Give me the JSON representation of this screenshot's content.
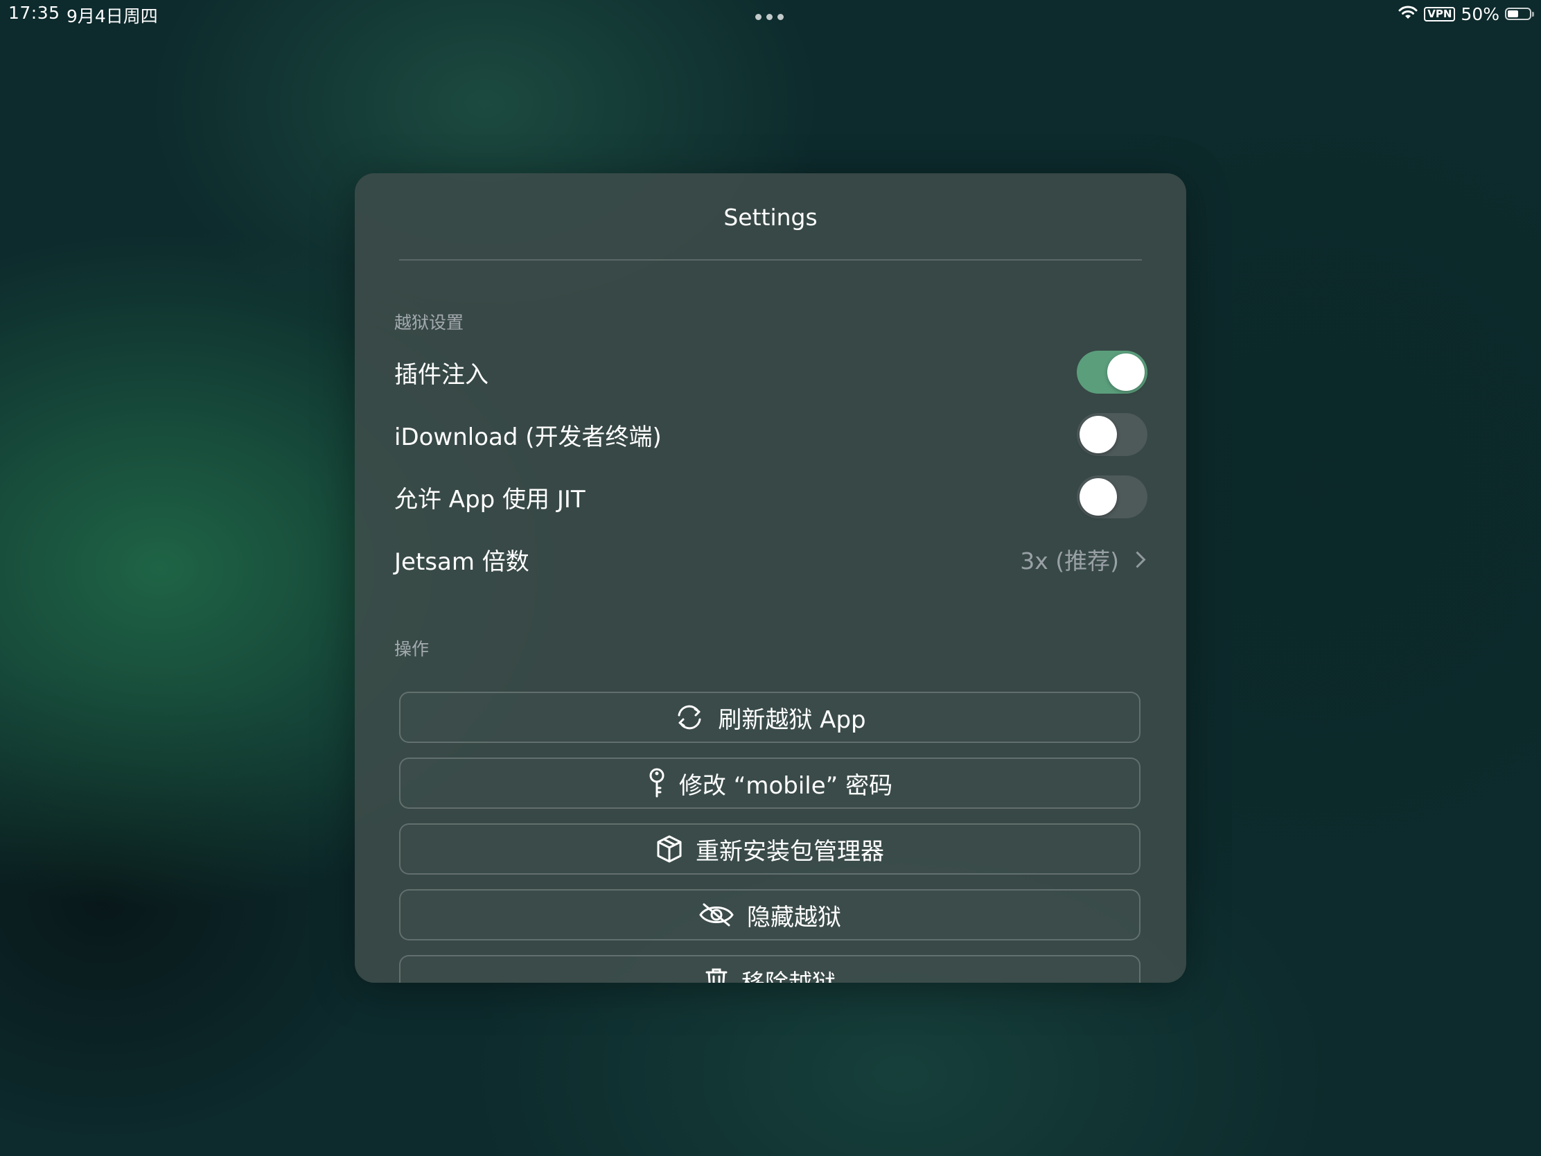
{
  "status_bar": {
    "time": "17:35",
    "date": "9月4日周四",
    "vpn": "VPN",
    "battery_percent": "50%",
    "battery_level": 0.5
  },
  "sheet": {
    "title": "Settings",
    "sections": {
      "jailbreak": {
        "header": "越狱设置",
        "tweak_injection": {
          "label": "插件注入",
          "on": true
        },
        "idownload": {
          "label": "iDownload (开发者终端)",
          "on": false
        },
        "allow_jit": {
          "label": "允许 App 使用 JIT",
          "on": false
        },
        "jetsam": {
          "label": "Jetsam 倍数",
          "value": "3x (推荐)"
        }
      },
      "actions": {
        "header": "操作",
        "buttons": [
          {
            "label": "刷新越狱 App",
            "icon": "refresh-icon"
          },
          {
            "label": "修改 “mobile” 密码",
            "icon": "key-icon"
          },
          {
            "label": "重新安装包管理器",
            "icon": "package-icon"
          },
          {
            "label": "隐藏越狱",
            "icon": "eye-slash-icon"
          },
          {
            "label": "移除越狱",
            "icon": "trash-icon"
          }
        ]
      }
    }
  },
  "colors": {
    "toggle_on": "#5b9e7c",
    "sheet_background": "#3e4c4a"
  }
}
